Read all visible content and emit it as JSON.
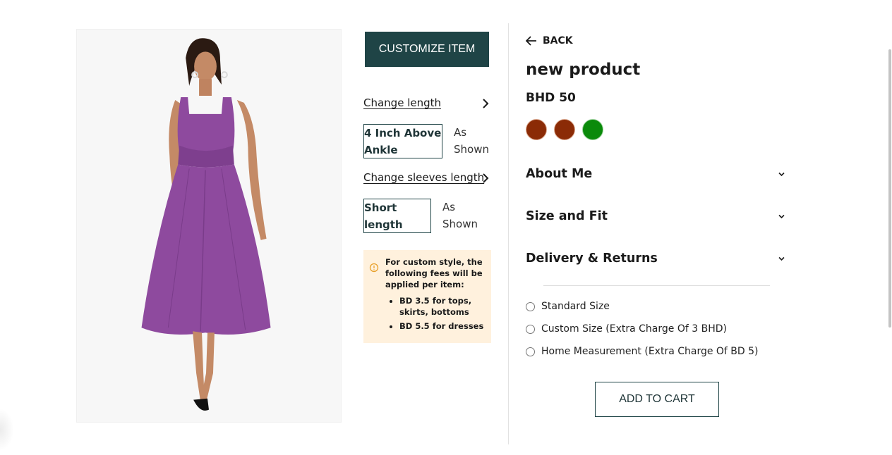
{
  "customize": {
    "button_label": "CUSTOMIZE ITEM",
    "length": {
      "link_label": "Change length",
      "selected": "4 Inch Above Ankle",
      "note": "As Shown"
    },
    "sleeves": {
      "link_label": "Change sleeves length",
      "selected": "Short length",
      "note": "As Shown"
    },
    "fees": {
      "intro": "For custom style, the following fees will be applied per item:",
      "items": [
        "BD 3.5 for tops, skirts, bottoms",
        "BD 5.5 for dresses"
      ]
    }
  },
  "details": {
    "back_label": "BACK",
    "title": "new product",
    "price": "BHD 50",
    "swatches": [
      "#8b2b06",
      "#8b2b06",
      "#0a8a0a"
    ],
    "accordions": [
      "About Me",
      "Size and Fit",
      "Delivery & Returns"
    ],
    "size_options": [
      "Standard Size",
      "Custom Size (Extra Charge Of 3 BHD)",
      "Home Measurement (Extra Charge Of BD 5)"
    ],
    "add_to_cart_label": "ADD TO CART"
  },
  "colors": {
    "accent": "#1f4446",
    "dress": "#8e4a9e",
    "fee_bg": "#fff1dd",
    "warning_icon": "#e8a02a"
  }
}
